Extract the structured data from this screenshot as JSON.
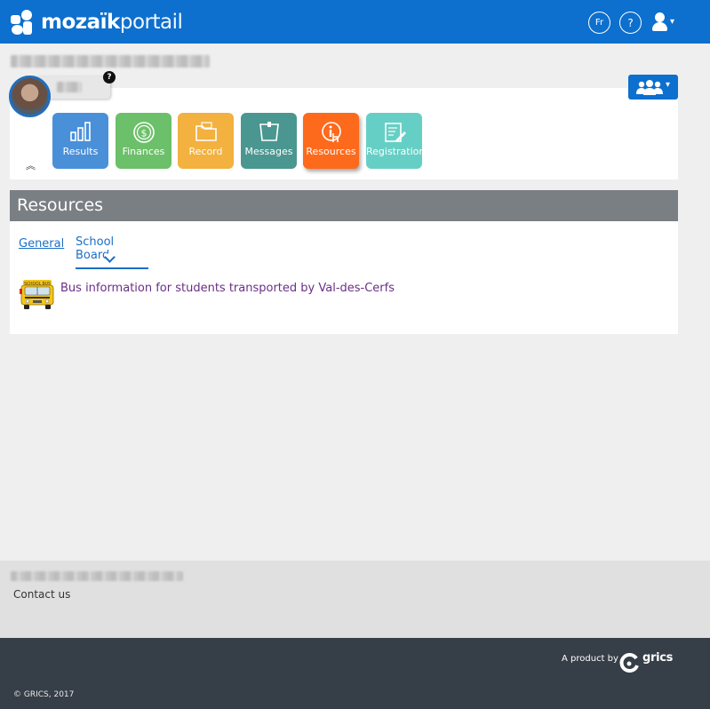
{
  "header": {
    "logo_bold": "mozaïk",
    "logo_light": "portail",
    "lang_button": "Fr",
    "help_button": "?",
    "user_menu_caret": "▾"
  },
  "student": {
    "help_badge": "?",
    "collapse_icon": "︽",
    "group_caret": "▾"
  },
  "tiles": [
    {
      "label": "Results",
      "color": "#4a90d9",
      "icon": "bar-chart-icon"
    },
    {
      "label": "Finances",
      "color": "#6cc06a",
      "icon": "dollar-coin-icon"
    },
    {
      "label": "Record",
      "color": "#f3b13f",
      "icon": "folder-icon"
    },
    {
      "label": "Messages",
      "color": "#4a9690",
      "icon": "note-icon"
    },
    {
      "label": "Resources",
      "color": "#fe6a1c",
      "icon": "info-hand-icon"
    },
    {
      "label": "Registration",
      "color": "#66cfc5",
      "icon": "form-pencil-icon"
    }
  ],
  "section": {
    "title": "Resources",
    "tabs": [
      {
        "label": "General",
        "active": false
      },
      {
        "label": "School Board",
        "active": true
      }
    ],
    "resource_item": "Bus information for students transported by Val-des-Cerfs"
  },
  "footer": {
    "contact": "Contact us",
    "product_by": "A product by",
    "brand": "grics",
    "copyright": "© GRICS, 2017"
  }
}
